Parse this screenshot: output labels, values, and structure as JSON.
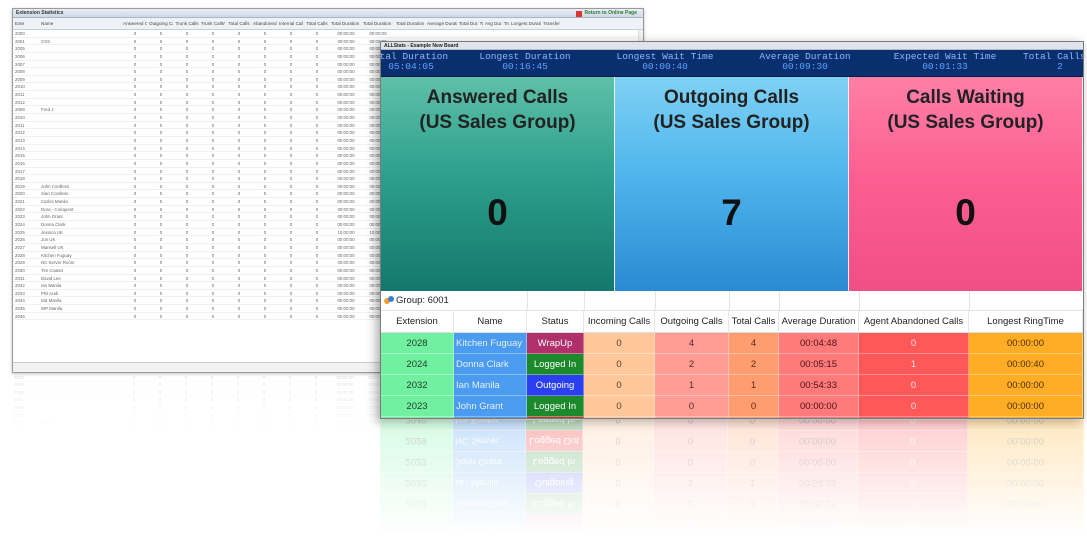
{
  "back_window": {
    "title": "Extension Statistics",
    "return_label": "Return to Online Page",
    "columns": [
      "Exte",
      "Name",
      "Answered Calls",
      "Outgoing Calls",
      "Trunk Calls",
      "Trunk Calls*",
      "Total Calls",
      "Abandoned Calls",
      "Internal Calls",
      "Total Calls",
      "Total Duration Incoming",
      "Total Duration Outgoing",
      "Total Duration",
      "Average Duration",
      "Total Dur. Trunk",
      "Avg Dur. Trunk",
      "Longest Duration",
      "Transfer"
    ],
    "rows": [
      {
        "ext": "2000",
        "name": "",
        "dur": "00:00:00"
      },
      {
        "ext": "2001",
        "name": "CSS",
        "dur": "00:00:00"
      },
      {
        "ext": "2005",
        "name": "",
        "dur": "00:00:00"
      },
      {
        "ext": "2006",
        "name": "",
        "dur": "00:00:00"
      },
      {
        "ext": "2007",
        "name": "",
        "dur": "00:00:00"
      },
      {
        "ext": "2008",
        "name": "",
        "dur": "00:00:00"
      },
      {
        "ext": "2009",
        "name": "",
        "dur": "00:00:00"
      },
      {
        "ext": "2010",
        "name": "",
        "dur": "00:00:00"
      },
      {
        "ext": "2011",
        "name": "",
        "dur": "00:00:00"
      },
      {
        "ext": "2012",
        "name": "",
        "dur": "00:00:00"
      },
      {
        "ext": "2008",
        "name": "Fred J",
        "dur": "00:00:00"
      },
      {
        "ext": "2010",
        "name": "",
        "dur": "00:00:00"
      },
      {
        "ext": "2011",
        "name": "",
        "dur": "00:00:00"
      },
      {
        "ext": "2012",
        "name": "",
        "dur": "00:00:00"
      },
      {
        "ext": "2013",
        "name": "",
        "dur": "00:00:00"
      },
      {
        "ext": "2014",
        "name": "",
        "dur": "00:00:00"
      },
      {
        "ext": "2015",
        "name": "",
        "dur": "00:00:00"
      },
      {
        "ext": "2016",
        "name": "",
        "dur": "00:00:00"
      },
      {
        "ext": "2017",
        "name": "",
        "dur": "00:00:00"
      },
      {
        "ext": "2018",
        "name": "",
        "dur": "00:00:00"
      },
      {
        "ext": "2019",
        "name": "John Cordless",
        "dur": "00:00:00"
      },
      {
        "ext": "2020",
        "name": "Sian Cordless",
        "dur": "00:00:00"
      },
      {
        "ext": "2021",
        "name": "Carlos Manila",
        "dur": "00:00:00"
      },
      {
        "ext": "2022",
        "name": "Dora - Conquest",
        "dur": "00:00:00"
      },
      {
        "ext": "2023",
        "name": "John Grant",
        "dur": "00:00:00"
      },
      {
        "ext": "2024",
        "name": "Donna Clark",
        "dur": "00:00:00"
      },
      {
        "ext": "2025",
        "name": "Jessica UK",
        "dur": "10:00:00"
      },
      {
        "ext": "2026",
        "name": "Jon UK",
        "dur": "00:00:00"
      },
      {
        "ext": "2027",
        "name": "Mansell UK",
        "dur": "00:00:00"
      },
      {
        "ext": "2028",
        "name": "Kitchen Fuguay",
        "dur": "00:00:00"
      },
      {
        "ext": "2029",
        "name": "NC Server Room",
        "dur": "00:00:00"
      },
      {
        "ext": "2030",
        "name": "Tim Coates",
        "dur": "00:00:00"
      },
      {
        "ext": "2031",
        "name": "David Lee",
        "dur": "00:00:00"
      },
      {
        "ext": "2032",
        "name": "Ian Manila",
        "dur": "00:00:00"
      },
      {
        "ext": "2033",
        "name": "Phil Audi",
        "dur": "00:00:00"
      },
      {
        "ext": "2034",
        "name": "Sid Manila",
        "dur": "00:00:00"
      },
      {
        "ext": "2035",
        "name": "WP Manila",
        "dur": "00:00:00"
      },
      {
        "ext": "2036",
        "name": "",
        "dur": "00:00:00"
      }
    ]
  },
  "front_window": {
    "title": "ALLStats - Example New Board",
    "ticker": [
      {
        "label": "otal Duration",
        "value": "05:04:05"
      },
      {
        "label": "Longest Duration",
        "value": "00:16:45"
      },
      {
        "label": "Longest Wait Time",
        "value": "00:00:40"
      },
      {
        "label": "Average Duration",
        "value": "00:09:30"
      },
      {
        "label": "Expected Wait Time",
        "value": "00:01:33"
      },
      {
        "label": "Total Calls (",
        "value": "2"
      }
    ],
    "panels": [
      {
        "title_line1": "Answered Calls",
        "title_line2": "(US Sales Group)",
        "value": "0"
      },
      {
        "title_line1": "Outgoing Calls",
        "title_line2": "(US Sales Group)",
        "value": "7"
      },
      {
        "title_line1": "Calls Waiting",
        "title_line2": "(US Sales Group)",
        "value": "0"
      }
    ],
    "group_label": "Group: 6001",
    "table_headers": [
      "Extension",
      "Name",
      "Status",
      "Incoming Calls",
      "Outgoing Calls",
      "Total Calls",
      "Average Duration",
      "Agent Abandoned Calls",
      "Longest RingTime"
    ],
    "rows": [
      {
        "ext": "2028",
        "name": "Kitchen Fuguay",
        "status": "WrapUp",
        "status_type": "wrapup",
        "incoming": "0",
        "outgoing": "4",
        "total": "4",
        "avg": "00:04:48",
        "abandoned": "0",
        "ring": "00:00:00"
      },
      {
        "ext": "2024",
        "name": "Donna Clark",
        "status": "Logged In",
        "status_type": "loggedin",
        "incoming": "0",
        "outgoing": "2",
        "total": "2",
        "avg": "00:05:15",
        "abandoned": "1",
        "ring": "00:00:40"
      },
      {
        "ext": "2032",
        "name": "Ian Manila",
        "status": "Outgoing",
        "status_type": "outgoing",
        "incoming": "0",
        "outgoing": "1",
        "total": "1",
        "avg": "00:54:33",
        "abandoned": "0",
        "ring": "00:00:00"
      },
      {
        "ext": "2023",
        "name": "John Grant",
        "status": "Logged In",
        "status_type": "loggedin",
        "incoming": "0",
        "outgoing": "0",
        "total": "0",
        "avg": "00:00:00",
        "abandoned": "0",
        "ring": "00:00:00"
      },
      {
        "ext": "2029",
        "name": "NC Server",
        "status": "Logged Out",
        "status_type": "loggedout",
        "incoming": "0",
        "outgoing": "0",
        "total": "0",
        "avg": "00:00:00",
        "abandoned": "0",
        "ring": "00:00:00"
      },
      {
        "ext": "2040",
        "name": "Ian Footer",
        "status": "Logged In",
        "status_type": "loggedin",
        "incoming": "0",
        "outgoing": "0",
        "total": "0",
        "avg": "00:00:00",
        "abandoned": "0",
        "ring": "00:00:00"
      }
    ]
  }
}
